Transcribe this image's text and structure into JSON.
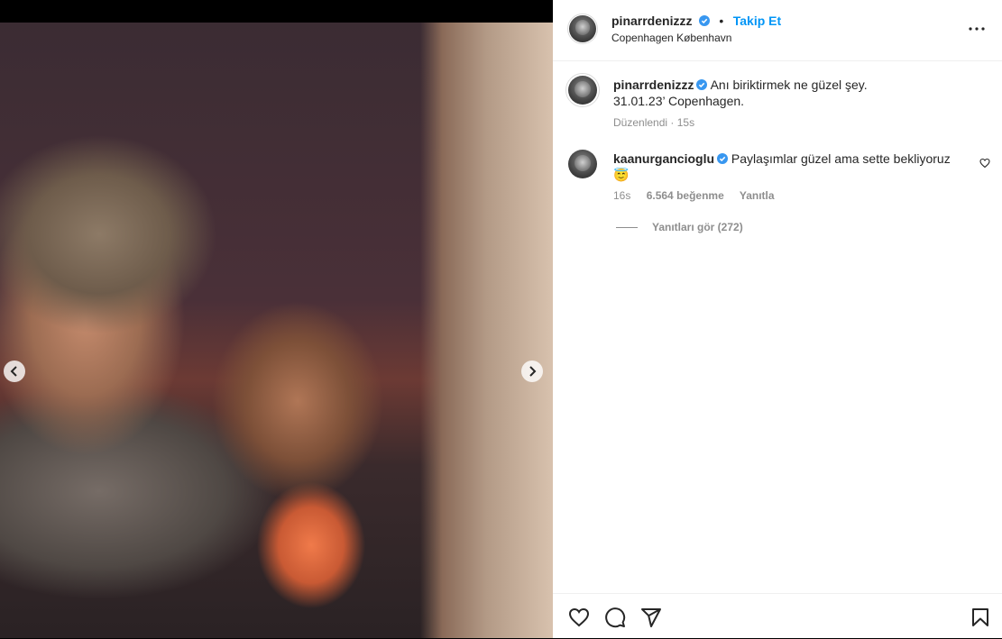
{
  "post": {
    "username": "pinarrdenizzz",
    "follow_label": "Takip Et",
    "separator": "•",
    "location": "Copenhagen København"
  },
  "caption": {
    "username": "pinarrdenizzz",
    "line1": "Anı biriktirmek ne güzel şey.",
    "line2": "31.01.23’ Copenhagen.",
    "edited": "Düzenlendi",
    "time": "· 15s"
  },
  "comment": {
    "username": "kaanurgancioglu",
    "text": "Paylaşımlar güzel ama sette bekliyoruz",
    "emoji": "😇",
    "time": "16s",
    "likes": "6.564 beğenme",
    "reply_label": "Yanıtla",
    "view_replies": "Yanıtları gör (272)"
  },
  "colors": {
    "accent": "#0095f6",
    "verified": "#3897f0",
    "text": "#262626",
    "muted": "#8e8e8e"
  },
  "icons": [
    "more-options-icon",
    "verified-badge-icon",
    "heart-icon",
    "comment-icon",
    "share-icon",
    "bookmark-icon",
    "chevron-left-icon",
    "chevron-right-icon"
  ]
}
